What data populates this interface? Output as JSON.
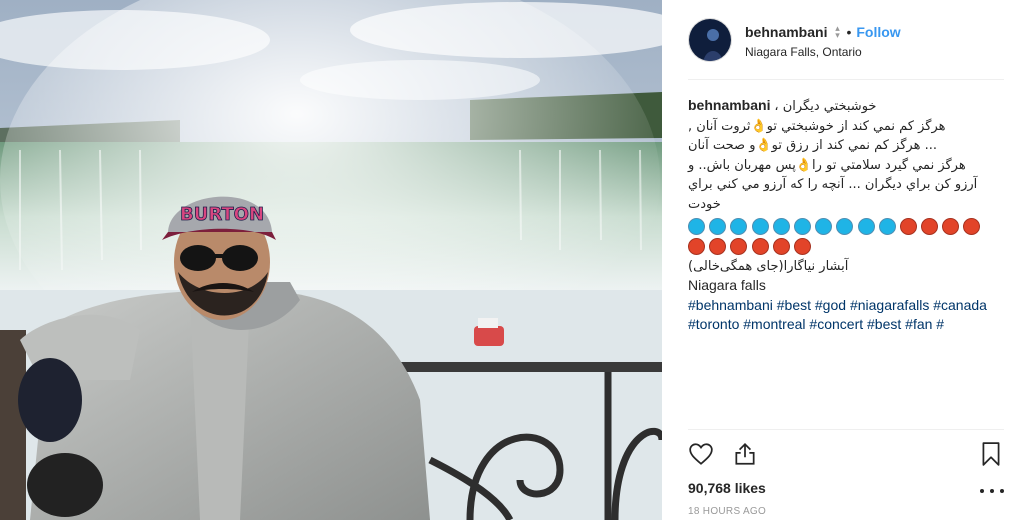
{
  "post": {
    "username": "behnambani",
    "follow_label": "Follow",
    "separator": "•",
    "location": "Niagara Falls, Ontario"
  },
  "photo": {
    "cap_text": "BURTON"
  },
  "caption": {
    "user": "behnambani",
    "line1": "خوشبختي ديگران ،",
    "lines": [
      "هرگز کم نمي کند از خوشبختي تو👌ثروت آنان ,",
      "... هرگز کم نمي کند از رزق تو👌و صحت آنان",
      "هرگز نمي گيرد سلامتي تو را👌پس مهربان باش.. و",
      "آرزو کن براي ديگران ... آنچه را که آرزو مي کني براي",
      "خودت"
    ],
    "circles": [
      "blue",
      "blue",
      "blue",
      "blue",
      "blue",
      "blue",
      "blue",
      "blue",
      "blue",
      "blue",
      "red",
      "red",
      "red",
      "red",
      "red",
      "red",
      "red",
      "red",
      "red",
      "red"
    ],
    "persian_tag": "آبشار نیاگارا(جای همگی‌خالی)",
    "english_line": "Niagara falls",
    "hashtags": [
      "#behnambani",
      "#best",
      "#god",
      "#niagarafalls",
      "#canada",
      "#toronto",
      "#montreal",
      "#concert",
      "#best",
      "#fan",
      "#"
    ]
  },
  "actions": {
    "like_icon": "heart-icon",
    "share_icon": "share-icon",
    "save_icon": "bookmark-icon",
    "more_icon": "more-dots-icon"
  },
  "stats": {
    "likes": "90,768 likes",
    "time": "18 HOURS AGO"
  },
  "colors": {
    "link": "#003569",
    "follow": "#3897f0",
    "circle_blue": "#1fb4e6",
    "circle_red": "#e24429"
  }
}
